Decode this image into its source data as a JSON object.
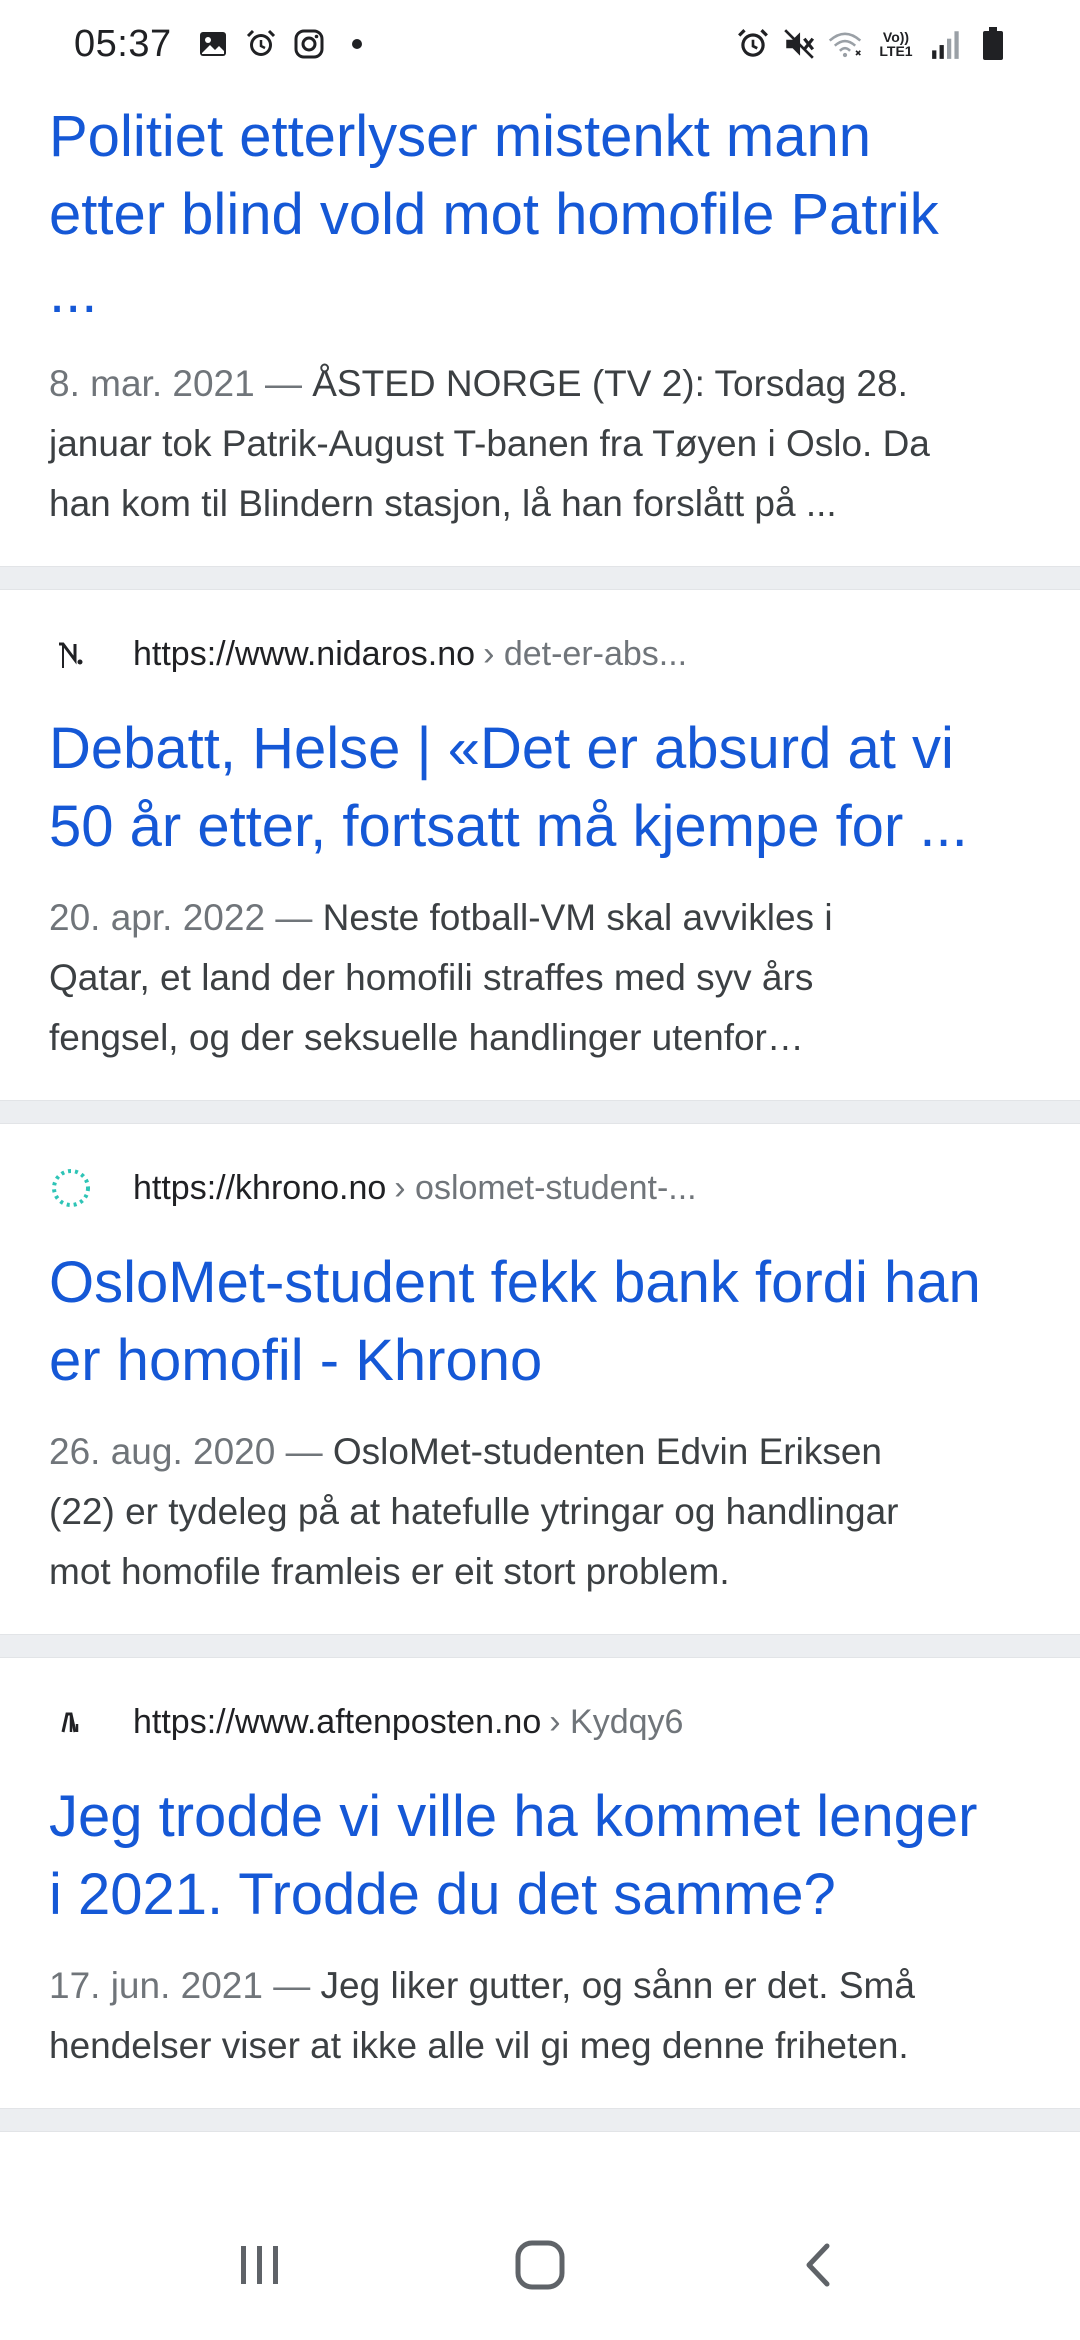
{
  "status_bar": {
    "time": "05:37",
    "left_icons": [
      "image-icon",
      "alarm-icon",
      "instagram-icon",
      "dot-icon"
    ],
    "right_icons": [
      "alarm-icon",
      "mute-icon",
      "wifi-icon",
      "volte-icon",
      "signal-icon",
      "battery-icon"
    ],
    "volte_top": "Vo))",
    "volte_bottom": "LTE1"
  },
  "results": [
    {
      "title_line1": "Politiet etterlyser mistenkt mann",
      "title_line2": "etter blind vold mot homofile Patrik",
      "title_line3": "...",
      "date": "8. mar. 2021",
      "sep": "—",
      "snippet_line1": "ÅSTED NORGE (TV 2): Torsdag 28.",
      "snippet_line2": "januar tok Patrik-August T-banen fra Tøyen i Oslo. Da",
      "snippet_line3": "han kom til Blindern stasjon, lå han forslått på ..."
    },
    {
      "url": "https://www.nidaros.no",
      "path": "› det-er-abs...",
      "favicon": "nidaros-icon",
      "title_line1": "Debatt, Helse | «Det er absurd at vi",
      "title_line2": "50 år etter, fortsatt må kjempe for ...",
      "date": "20. apr. 2022",
      "sep": "—",
      "snippet_line1": "Neste fotball-VM skal avvikles i",
      "snippet_line2": "Qatar, et land der homofili straffes med syv års",
      "snippet_line3": "fengsel, og der seksuelle handlinger utenfor…"
    },
    {
      "url": "https://khrono.no",
      "path": "› oslomet-student-...",
      "favicon": "khrono-icon",
      "title_line1": "OsloMet-student fekk bank fordi han",
      "title_line2": "er homofil - Khrono",
      "date": "26. aug. 2020",
      "sep": "—",
      "snippet_line1": "OsloMet-studenten Edvin Eriksen",
      "snippet_line2": "(22) er tydeleg på at hatefulle ytringar og handlingar",
      "snippet_line3": "mot homofile framleis er eit stort problem."
    },
    {
      "url": "https://www.aftenposten.no",
      "path": "› Kydqy6",
      "favicon": "aftenposten-icon",
      "title_line1": "Jeg trodde vi ville ha kommet lenger",
      "title_line2": "i 2021. Trodde du det samme?",
      "date": "17. jun. 2021",
      "sep": "—",
      "snippet_line1": "Jeg liker gutter, og sånn er det. Små",
      "snippet_line2": "hendelser viser at ikke alle vil gi meg denne friheten."
    }
  ],
  "nav_bar": {
    "buttons": [
      "recent-apps-icon",
      "home-icon",
      "back-icon"
    ]
  },
  "colors": {
    "link": "#1558d6",
    "snippet": "#3c4043",
    "date": "#70757a",
    "separator": "#eceef1",
    "khrono_accent": "#2ec4b6"
  }
}
